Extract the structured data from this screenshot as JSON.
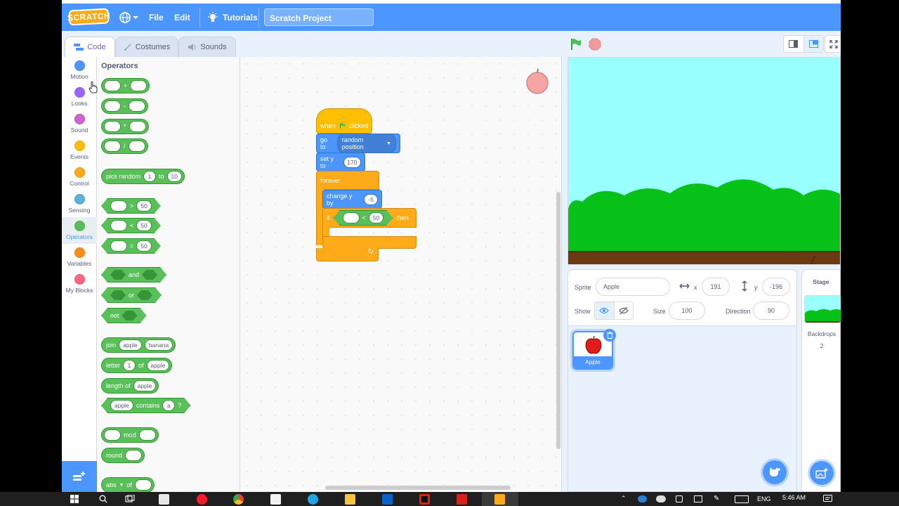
{
  "menubar": {
    "logo": "SCRATCH",
    "file": "File",
    "edit": "Edit",
    "tutorials": "Tutorials",
    "project_title": "Scratch Project"
  },
  "tabs": {
    "code": "Code",
    "costumes": "Costumes",
    "sounds": "Sounds"
  },
  "categories": [
    {
      "label": "Motion",
      "color": "#4c97ff"
    },
    {
      "label": "Looks",
      "color": "#9966ff"
    },
    {
      "label": "Sound",
      "color": "#cf63cf"
    },
    {
      "label": "Events",
      "color": "#ffbf00"
    },
    {
      "label": "Control",
      "color": "#ffab19"
    },
    {
      "label": "Sensing",
      "color": "#5cb1d6"
    },
    {
      "label": "Operators",
      "color": "#59c059"
    },
    {
      "label": "Variables",
      "color": "#ff8c1a"
    },
    {
      "label": "My Blocks",
      "color": "#ff6680"
    }
  ],
  "palette": {
    "title": "Operators",
    "add": "+",
    "sub": "-",
    "mul": "*",
    "div": "/",
    "pick_random": "pick random",
    "pick_from": "1",
    "pick_to_word": "to",
    "pick_to": "10",
    "gt": ">",
    "lt": "<",
    "eq": "=",
    "cmp_val": "50",
    "and": "and",
    "or": "or",
    "not": "not",
    "join": "join",
    "join_a": "apple",
    "join_b": "banana",
    "letter": "letter",
    "letter_n": "1",
    "of": "of",
    "letter_of": "apple",
    "length_of": "length of",
    "length_val": "apple",
    "contains_a": "apple",
    "contains": "contains",
    "contains_b": "a",
    "q": "?",
    "mod": "mod",
    "round": "round",
    "abs": "abs"
  },
  "script": {
    "when": "when",
    "clicked": "clicked",
    "go_to": "go to",
    "go_to_val": "random position",
    "set_y": "set y to",
    "set_y_val": "170",
    "forever": "forever",
    "change_y": "change y by",
    "change_y_val": "-5",
    "if": "if",
    "then": "then",
    "if_op": "<",
    "if_val": "50"
  },
  "sprite_info": {
    "sprite_label": "Sprite",
    "sprite_name": "Apple",
    "x_label": "x",
    "x": "191",
    "y_label": "y",
    "y": "-196",
    "show_label": "Show",
    "size_label": "Size",
    "size": "100",
    "direction_label": "Direction",
    "direction": "90"
  },
  "sprites": [
    {
      "name": "Apple"
    }
  ],
  "stage_pane": {
    "title": "Stage",
    "backdrops_label": "Backdrops",
    "backdrops_count": "2"
  },
  "taskbar": {
    "lang": "ENG",
    "time": "5:46 AM"
  }
}
